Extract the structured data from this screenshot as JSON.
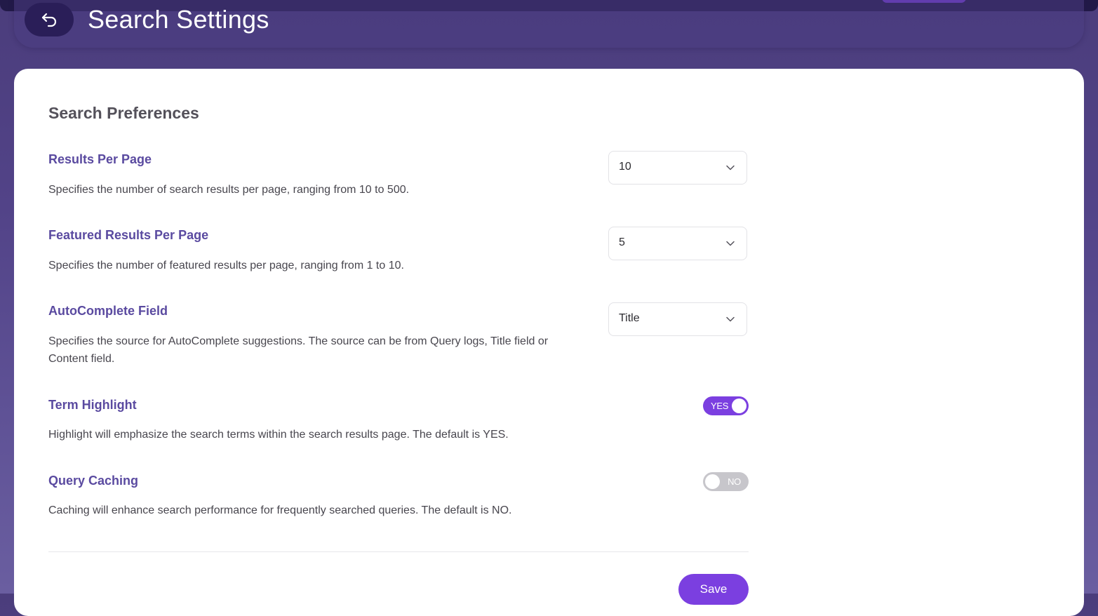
{
  "header": {
    "title": "Search Settings",
    "back_icon": "undo-arrow-icon"
  },
  "card": {
    "section_title": "Search Preferences",
    "settings": [
      {
        "label": "Results Per Page",
        "description": "Specifies the number of search results per page, ranging from 10 to 500.",
        "control": "select",
        "value": "10"
      },
      {
        "label": "Featured Results Per Page",
        "description": "Specifies the number of featured results per page, ranging from 1 to 10.",
        "control": "select",
        "value": "5"
      },
      {
        "label": "AutoComplete Field",
        "description": "Specifies the source for AutoComplete suggestions. The source can be from Query logs, Title field or Content field.",
        "control": "select",
        "value": "Title"
      },
      {
        "label": "Term Highlight",
        "description": "Highlight will emphasize the search terms within the search results page. The default is YES.",
        "control": "toggle",
        "value": "YES"
      },
      {
        "label": "Query Caching",
        "description": "Caching will enhance search performance for frequently searched queries. The default is NO.",
        "control": "toggle",
        "value": "NO"
      }
    ],
    "save_label": "Save"
  },
  "colors": {
    "accent": "#7b3fe0",
    "label": "#5a4aa0",
    "toggle_off": "#c7c6cb",
    "background_top": "#4b3d7c"
  }
}
